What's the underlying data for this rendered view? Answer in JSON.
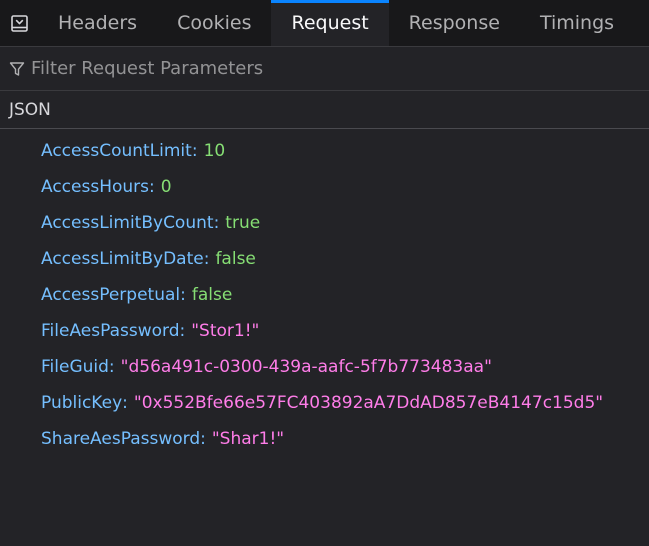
{
  "toolbar": {
    "toggle_icon": "sidebar-toggle-icon",
    "tabs": [
      {
        "label": "Headers",
        "selected": false
      },
      {
        "label": "Cookies",
        "selected": false
      },
      {
        "label": "Request",
        "selected": true
      },
      {
        "label": "Response",
        "selected": false
      },
      {
        "label": "Timings",
        "selected": false
      }
    ]
  },
  "filter": {
    "icon": "filter-icon",
    "placeholder": "Filter Request Parameters",
    "value": ""
  },
  "section": {
    "title": "JSON"
  },
  "params": [
    {
      "key": "AccessCountLimit",
      "value": "10",
      "type": "number"
    },
    {
      "key": "AccessHours",
      "value": "0",
      "type": "number"
    },
    {
      "key": "AccessLimitByCount",
      "value": "true",
      "type": "bool"
    },
    {
      "key": "AccessLimitByDate",
      "value": "false",
      "type": "bool"
    },
    {
      "key": "AccessPerpetual",
      "value": "false",
      "type": "bool"
    },
    {
      "key": "FileAesPassword",
      "value": "\"Stor1!\"",
      "type": "string"
    },
    {
      "key": "FileGuid",
      "value": "\"d56a491c-0300-439a-aafc-5f7b773483aa\"",
      "type": "string"
    },
    {
      "key": "PublicKey",
      "value": "\"0x552Bfe66e57FC403892aA7DdAD857eB4147c15d5\"",
      "type": "string"
    },
    {
      "key": "ShareAesPassword",
      "value": "\"Shar1!\"",
      "type": "string"
    }
  ],
  "colors": {
    "key": "#75bfff",
    "number": "#86de74",
    "bool": "#86de74",
    "string": "#ff7de9",
    "accent": "#0a84ff",
    "background": "#232327"
  }
}
